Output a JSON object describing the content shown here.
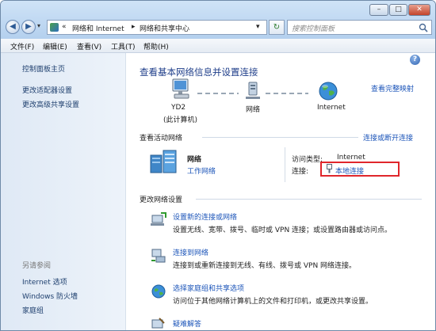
{
  "window": {
    "controls": {
      "minimize": "–",
      "maximize": "□",
      "close": "✕"
    }
  },
  "nav": {
    "back": "◀",
    "forward": "▶",
    "dropdown": "▾"
  },
  "address": {
    "crumbs": [
      "«",
      "网络和 Internet",
      "▸",
      "网络和共享中心"
    ],
    "dropdown": "▾",
    "refresh": "↻"
  },
  "search": {
    "placeholder": "搜索控制面板"
  },
  "menu": [
    "文件(F)",
    "编辑(E)",
    "查看(V)",
    "工具(T)",
    "帮助(H)"
  ],
  "sidebar": {
    "top_links": [
      "控制面板主页",
      "更改适配器设置",
      "更改高级共享设置"
    ],
    "see_also_title": "另请参阅",
    "see_also_links": [
      "Internet 选项",
      "Windows 防火墙",
      "家庭组"
    ]
  },
  "main": {
    "title": "查看基本网络信息并设置连接",
    "view_full_map": "查看完整映射",
    "map": {
      "computer_name": "YD2",
      "computer_sub": "(此计算机)",
      "network": "网络",
      "internet": "Internet"
    },
    "active_title": "查看活动网络",
    "connect_disconnect": "连接或断开连接",
    "active": {
      "name": "网络",
      "type": "工作网络",
      "access_label": "访问类型:",
      "access_value": "Internet",
      "conn_label": "连接:",
      "conn_value": "本地连接"
    },
    "change_title": "更改网络设置",
    "tasks": [
      {
        "title": "设置新的连接或网络",
        "desc": "设置无线、宽带、拨号、临时或 VPN 连接；或设置路由器或访问点。"
      },
      {
        "title": "连接到网络",
        "desc": "连接到或重新连接到无线、有线、拨号或 VPN 网络连接。"
      },
      {
        "title": "选择家庭组和共享选项",
        "desc": "访问位于其他网络计算机上的文件和打印机，或更改共享设置。"
      },
      {
        "title": "疑难解答",
        "desc": ""
      }
    ]
  },
  "colors": {
    "link": "#1c55b9",
    "title": "#1f3e8a",
    "highlight_box": "#e0262b"
  }
}
